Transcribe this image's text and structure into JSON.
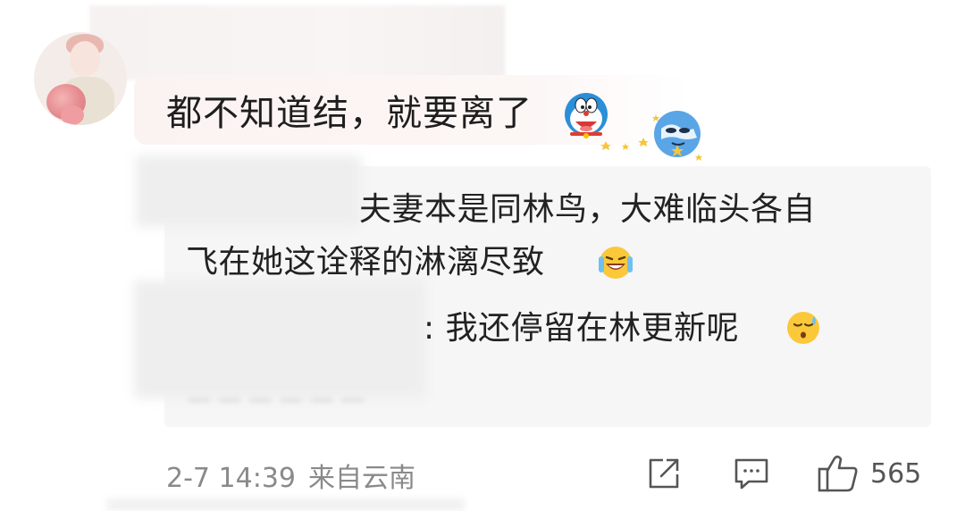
{
  "comment": {
    "text": "都不知道结，就要离了",
    "emojis": [
      "doraemon-emoji",
      "earth-star-emoji"
    ]
  },
  "reply_panel": {
    "reply1": {
      "line1": "夫妻本是同林鸟，大难临头各自",
      "line2": "飞在她这诠释的淋漓尽致",
      "emoji": "laugh-cry-emoji"
    },
    "reply2": {
      "text": ": 我还停留在林更新呢",
      "emoji": "sweat-emoji"
    }
  },
  "footer": {
    "date": "2-7 14:39",
    "location": "来自云南",
    "like_count": "565"
  },
  "colors": {
    "text_primary": "#1e1e1e",
    "text_meta": "#8a8a8a",
    "panel_bg": "#f6f6f7",
    "icon": "#555555"
  },
  "icons": [
    "share-icon",
    "comment-icon",
    "like-icon"
  ]
}
